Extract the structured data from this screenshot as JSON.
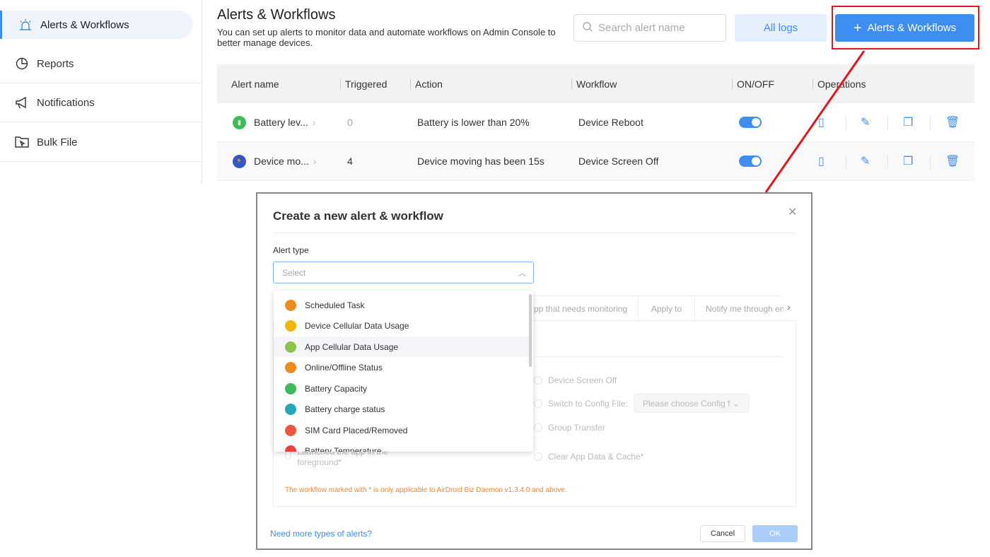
{
  "sidebar": {
    "items": [
      {
        "label": "Alerts & Workflows",
        "icon": "alert-icon",
        "active": true
      },
      {
        "label": "Reports",
        "icon": "pie-chart-icon"
      },
      {
        "label": "Notifications",
        "icon": "megaphone-icon"
      },
      {
        "label": "Bulk File",
        "icon": "folder-cursor-icon"
      }
    ]
  },
  "header": {
    "title": "Alerts & Workflows",
    "description": "You can set up alerts to monitor data and automate workflows on Admin Console to better manage devices.",
    "search_placeholder": "Search alert name",
    "all_logs": "All logs",
    "create_button": "Alerts & Workflows"
  },
  "table": {
    "columns": [
      "Alert name",
      "Triggered",
      "Action",
      "Workflow",
      "ON/OFF",
      "Operations"
    ],
    "rows": [
      {
        "name": "Battery lev...",
        "icon": "battery-icon",
        "icon_color": "#3dbb5a",
        "triggered": "0",
        "action": "Battery is lower than 20%",
        "workflow": "Device Reboot",
        "on": true
      },
      {
        "name": "Device mo...",
        "icon": "running-icon",
        "icon_color": "#3456c8",
        "triggered": "4",
        "action": "Device moving has been 15s",
        "workflow": "Device Screen Off",
        "on": true
      }
    ]
  },
  "modal": {
    "title": "Create a new alert & workflow",
    "alert_type_label": "Alert type",
    "select_placeholder": "Select",
    "options": [
      {
        "label": "Scheduled Task",
        "color": "#f08c1e"
      },
      {
        "label": "Device Cellular Data Usage",
        "color": "#f5b400"
      },
      {
        "label": "App Cellular Data Usage",
        "color": "#8cc34a",
        "highlighted": true
      },
      {
        "label": "Online/Offline Status",
        "color": "#f08c1e"
      },
      {
        "label": "Battery Capacity",
        "color": "#3dbb5a"
      },
      {
        "label": "Battery charge status",
        "color": "#21a7b8"
      },
      {
        "label": "SIM Card Placed/Removed",
        "color": "#f0553e"
      },
      {
        "label": "Battery Temperature",
        "color": "#f0403e"
      }
    ],
    "tabs": [
      "pp that needs monitoring",
      "Apply to",
      "Notify me through en"
    ],
    "workflow_options": {
      "screen_off": "Device Screen Off",
      "config": "Switch to Config File:",
      "config_placeholder": "Please choose Config f",
      "group": "Group Transfer",
      "clear": "Clear App Data & Cache*",
      "launch": "Launched the app in the foreground*"
    },
    "note": "The workflow marked with * is only applicable to AirDroid Biz Daemon v1.3.4.0 and above.",
    "more_link": "Need more types of alerts?",
    "cancel": "Cancel",
    "ok": "OK"
  },
  "colors": {
    "accent": "#3d8ef0",
    "highlight": "#e8141c",
    "note": "#f0882e"
  }
}
